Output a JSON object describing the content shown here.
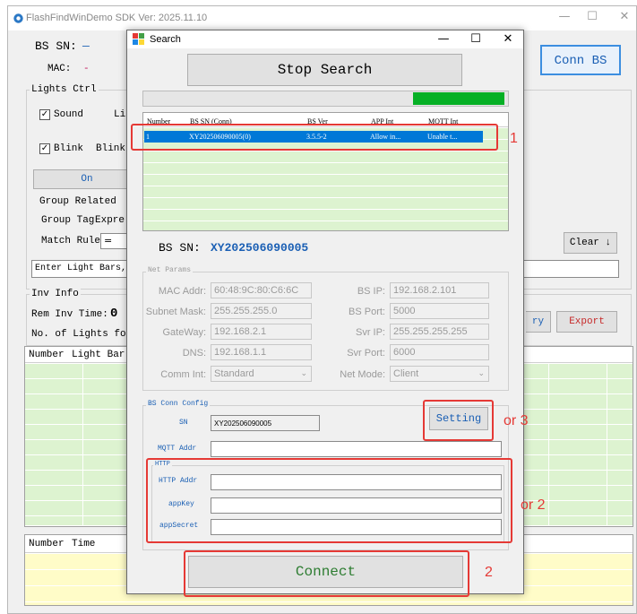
{
  "main_window": {
    "title": "FlashFindWinDemo SDK Ver: 2025.11.10",
    "bs_sn_label": "BS SN:",
    "bs_sn_value": "—",
    "mac_label": "MAC:",
    "mac_value": "-",
    "conn_bs_button": "Conn BS",
    "lights_ctrl_legend": "Lights Ctrl",
    "sound_label": "Sound",
    "lights_partial": "Li",
    "blink_label": "Blink",
    "blink_partial": "Blink",
    "on_button": "On",
    "group_related_label": "Group Related",
    "group_tag_label": "Group Tag",
    "express_partial": "Expre",
    "match_rules_label": "Match Rules",
    "match_rules_value": "=",
    "clear_button": "Clear",
    "enter_light_bars_placeholder": "Enter Light Bars, (",
    "inv_info_legend": "Inv Info",
    "rem_inv_time_label": "Rem Inv Time:",
    "rem_inv_time_value": "0",
    "no_of_lights_label": "No. of Lights for I",
    "query_partial": "ry",
    "export_button": "Export",
    "table1_headers": [
      "Number",
      "Light Bar I"
    ],
    "table2_headers": [
      "Number",
      "Time"
    ]
  },
  "search_dialog": {
    "title": "Search",
    "stop_search_button": "Stop Search",
    "progress_fraction": 0.25,
    "device_table": {
      "headers": [
        "Number",
        "BS SN (Conn)",
        "BS Ver",
        "APP Int",
        "MQTT Int"
      ],
      "rows": [
        [
          "1",
          "XY202506090005(0)",
          "3.5.5-2",
          "Allow in...",
          "Unable t..."
        ]
      ]
    },
    "bs_sn_label": "BS SN:",
    "bs_sn_value": "XY202506090005",
    "net_params_legend": "Net Params",
    "mac_addr_label": "MAC Addr:",
    "mac_addr_value": "60:48:9C:80:C6:6C",
    "bs_ip_label": "BS IP:",
    "bs_ip_value": "192.168.2.101",
    "subnet_mask_label": "Subnet Mask:",
    "subnet_mask_value": "255.255.255.0",
    "bs_port_label": "BS Port:",
    "bs_port_value": "5000",
    "gateway_label": "GateWay:",
    "gateway_value": "192.168.2.1",
    "svr_ip_label": "Svr IP:",
    "svr_ip_value": "255.255.255.255",
    "dns_label": "DNS:",
    "dns_value": "192.168.1.1",
    "svr_port_label": "Svr Port:",
    "svr_port_value": "6000",
    "comm_int_label": "Comm Int:",
    "comm_int_value": "Standard",
    "net_mode_label": "Net Mode:",
    "net_mode_value": "Client",
    "bs_conn_config_legend": "BS Conn Config",
    "sn_label": "SN",
    "sn_value": "XY202506090005",
    "setting_button": "Setting",
    "mqtt_addr_label": "MQTT Addr",
    "http_legend": "HTTP",
    "http_addr_label": "HTTP Addr",
    "app_key_label": "appKey",
    "app_secret_label": "appSecret",
    "connect_button": "Connect"
  },
  "annotations": {
    "label_1": "1",
    "label_2": "2",
    "label_or2": "or 2",
    "label_or3": "or 3",
    "color": "#e53935"
  }
}
